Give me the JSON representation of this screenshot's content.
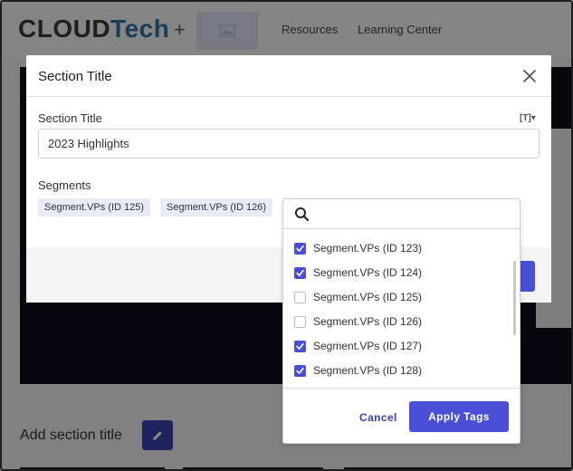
{
  "background": {
    "logo_part1": "CLOUD",
    "logo_part2": "Tech",
    "plus_sign": "+",
    "nav": [
      "Resources",
      "Learning Center"
    ],
    "add_section_title": "Add section title"
  },
  "modal": {
    "title": "Section Title",
    "field_label": "Section Title",
    "format_tag": "[T]▾",
    "title_value": "2023 Highlights",
    "segments_label": "Segments",
    "chips": [
      "Segment.VPs (ID 125)",
      "Segment.VPs (ID 126)"
    ]
  },
  "dropdown": {
    "search_value": "",
    "items": [
      {
        "label": "Segment.VPs (ID 123)",
        "checked": true
      },
      {
        "label": "Segment.VPs (ID 124)",
        "checked": true
      },
      {
        "label": "Segment.VPs (ID 125)",
        "checked": false
      },
      {
        "label": "Segment.VPs (ID 126)",
        "checked": false
      },
      {
        "label": "Segment.VPs (ID 127)",
        "checked": true
      },
      {
        "label": "Segment.VPs (ID 128)",
        "checked": true
      }
    ],
    "cancel_label": "Cancel",
    "apply_label": "Apply Tags"
  },
  "colors": {
    "accent": "#4a4fd8",
    "accent_dark": "#3b3fb0",
    "logo_blue": "#2f6f9e"
  }
}
